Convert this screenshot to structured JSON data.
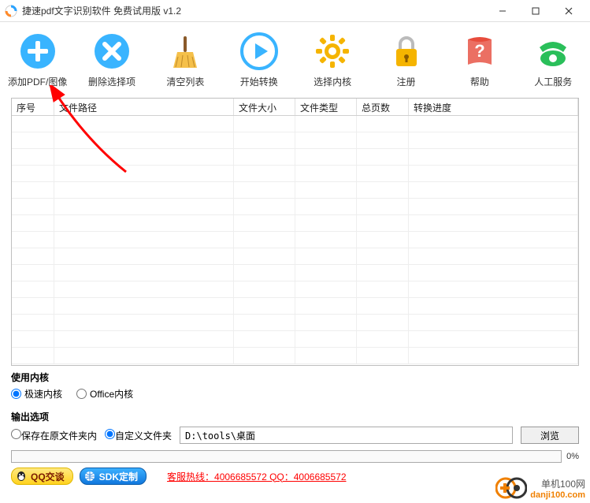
{
  "window": {
    "title": "捷速pdf文字识别软件 免费试用版  v1.2"
  },
  "toolbar": {
    "add": "添加PDF/图像",
    "remove": "删除选择项",
    "clear": "清空列表",
    "start": "开始转换",
    "kernel": "选择内核",
    "register": "注册",
    "help": "帮助",
    "service": "人工服务"
  },
  "grid": {
    "cols": {
      "seq": "序号",
      "path": "文件路径",
      "size": "文件大小",
      "type": "文件类型",
      "pages": "总页数",
      "progress": "转换进度"
    }
  },
  "kernel_section": {
    "title": "使用内核",
    "fast": "极速内核",
    "office": "Office内核"
  },
  "output_section": {
    "title": "输出选项",
    "save_orig": "保存在原文件夹内",
    "save_custom": "自定义文件夹",
    "path": "D:\\tools\\桌面",
    "browse": "浏览"
  },
  "progress": {
    "pct": "0%"
  },
  "footer": {
    "qq": "QQ交谈",
    "sdk": "SDK定制",
    "hotline": "客服热线：4006685572 QQ：4006685572"
  },
  "watermark": {
    "cn": "单机100网",
    "url": "danji100.com"
  }
}
